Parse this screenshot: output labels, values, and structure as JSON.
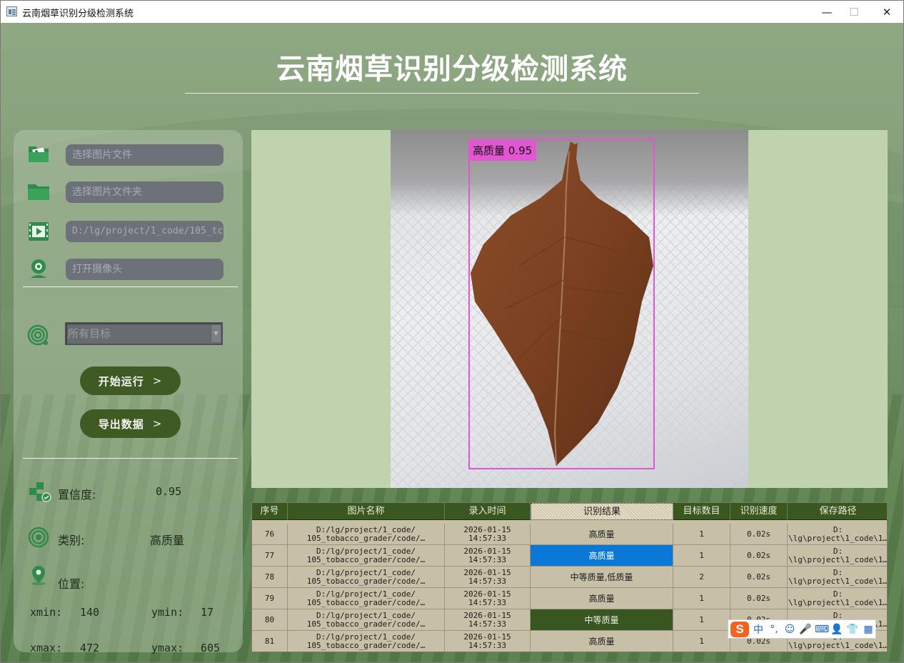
{
  "window": {
    "title": "云南烟草识别分级检测系统",
    "minimize": "—",
    "maximize": "☐",
    "close": "✕"
  },
  "header": {
    "title": "云南烟草识别分级检测系统"
  },
  "controls": {
    "image_file_placeholder": "选择图片文件",
    "image_folder_placeholder": "选择图片文件夹",
    "video_path": "D:/lg/project/1_code/105_tc",
    "camera_placeholder": "打开摄像头",
    "target_select": "所有目标",
    "start_button": "开始运行",
    "export_button": "导出数据",
    "chevron": ">"
  },
  "info": {
    "confidence_label": "置信度:",
    "confidence_value": "0.95",
    "class_label": "类别:",
    "class_value": "高质量",
    "position_label": "位置:",
    "xmin_label": "xmin:",
    "xmin": "140",
    "ymin_label": "ymin:",
    "ymin": "17",
    "xmax_label": "xmax:",
    "xmax": "472",
    "ymax_label": "ymax:",
    "ymax": "605"
  },
  "detection": {
    "label": "高质量 0.95",
    "box_color": "#e256d4"
  },
  "table": {
    "headers": [
      "序号",
      "图片名称",
      "录入时间",
      "识别结果",
      "目标数目",
      "识别速度",
      "保存路径"
    ],
    "rows": [
      {
        "id": "76",
        "name": "D:/lg/project/1_code/\n105_tobacco_grader/code/…",
        "time": "2026-01-15\n14:57:33",
        "result": "高质量",
        "count": "1",
        "speed": "0.02s",
        "path": "D:\n\\lg\\project\\1_code\\1…"
      },
      {
        "id": "77",
        "name": "D:/lg/project/1_code/\n105_tobacco_grader/code/…",
        "time": "2026-01-15\n14:57:33",
        "result": "高质量",
        "count": "1",
        "speed": "0.02s",
        "path": "D:\n\\lg\\project\\1_code\\1…"
      },
      {
        "id": "78",
        "name": "D:/lg/project/1_code/\n105_tobacco_grader/code/…",
        "time": "2026-01-15\n14:57:33",
        "result": "中等质量,低质量",
        "count": "2",
        "speed": "0.02s",
        "path": "D:\n\\lg\\project\\1_code\\1…"
      },
      {
        "id": "79",
        "name": "D:/lg/project/1_code/\n105_tobacco_grader/code/…",
        "time": "2026-01-15\n14:57:33",
        "result": "高质量",
        "count": "1",
        "speed": "0.02s",
        "path": "D:\n\\lg\\project\\1_code\\1…"
      },
      {
        "id": "80",
        "name": "D:/lg/project/1_code/\n105_tobacco_grader/code/…",
        "time": "2026-01-15\n14:57:33",
        "result": "中等质量",
        "count": "1",
        "speed": "0.02s",
        "path": "D:\n\\lg\\project\\1_code\\1…"
      },
      {
        "id": "81",
        "name": "D:/lg/project/1_code/\n105_tobacco_grader/code/…",
        "time": "2026-01-15\n14:57:33",
        "result": "高质量",
        "count": "1",
        "speed": "0.02s",
        "path": "D:\n\\lg\\project\\1_code\\1…"
      }
    ]
  },
  "ime": {
    "logo": "S",
    "mode": "中",
    "punct": "°,",
    "emoji": "☺",
    "mic": "🎤",
    "keyboard": "⌨",
    "user": "👤",
    "skin": "👕",
    "tools": "▦"
  }
}
